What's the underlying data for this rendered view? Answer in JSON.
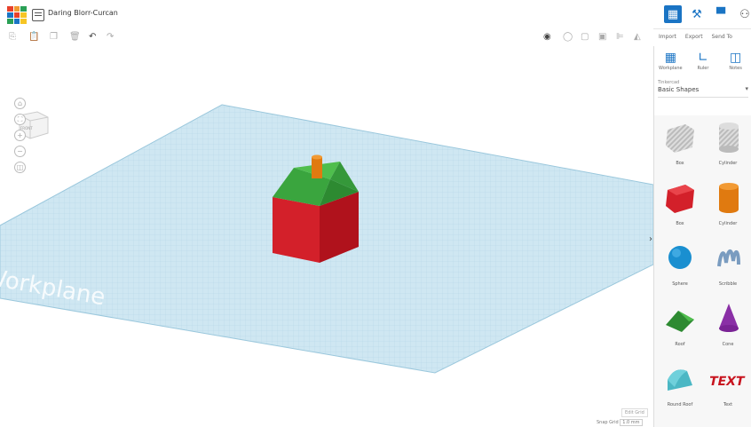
{
  "header": {
    "title": "Daring Blorr-Curcan",
    "logo_colors": [
      "#e8412b",
      "#f09a31",
      "#2aa055",
      "#1a74c4",
      "#e8412b",
      "#f6c524",
      "#2aa055",
      "#1a74c4",
      "#f6c524"
    ]
  },
  "toolbar": {
    "import_label": "Import",
    "export_label": "Export",
    "send_label": "Send To"
  },
  "panel": {
    "tools": [
      {
        "label": "Workplane",
        "icon": "workplane-icon"
      },
      {
        "label": "Ruler",
        "icon": "ruler-icon"
      },
      {
        "label": "Notes",
        "icon": "notes-icon"
      }
    ],
    "category_label": "Tinkercad",
    "category_value": "Basic Shapes",
    "shapes": [
      {
        "label": "Box",
        "icon": "box-hole-icon"
      },
      {
        "label": "Cylinder",
        "icon": "cylinder-hole-icon"
      },
      {
        "label": "Box",
        "icon": "box-icon"
      },
      {
        "label": "Cylinder",
        "icon": "cylinder-icon"
      },
      {
        "label": "Sphere",
        "icon": "sphere-icon"
      },
      {
        "label": "Scribble",
        "icon": "scribble-icon"
      },
      {
        "label": "Roof",
        "icon": "roof-icon"
      },
      {
        "label": "Cone",
        "icon": "cone-icon"
      },
      {
        "label": "Round Roof",
        "icon": "round-roof-icon"
      },
      {
        "label": "Text",
        "icon": "text-shape-icon"
      }
    ]
  },
  "viewport": {
    "workplane_label": "Workplane",
    "viewcube_face": "FRONT",
    "edit_grid_label": "Edit Grid",
    "snap_grid_label": "Snap Grid",
    "snap_grid_value": "1.0 mm"
  },
  "colors": {
    "accent": "#1a74c4",
    "workplane": "#cfe7f2",
    "box_red": "#d3202a",
    "roof_green": "#3aa53e",
    "chimney_orange": "#e07a10"
  }
}
